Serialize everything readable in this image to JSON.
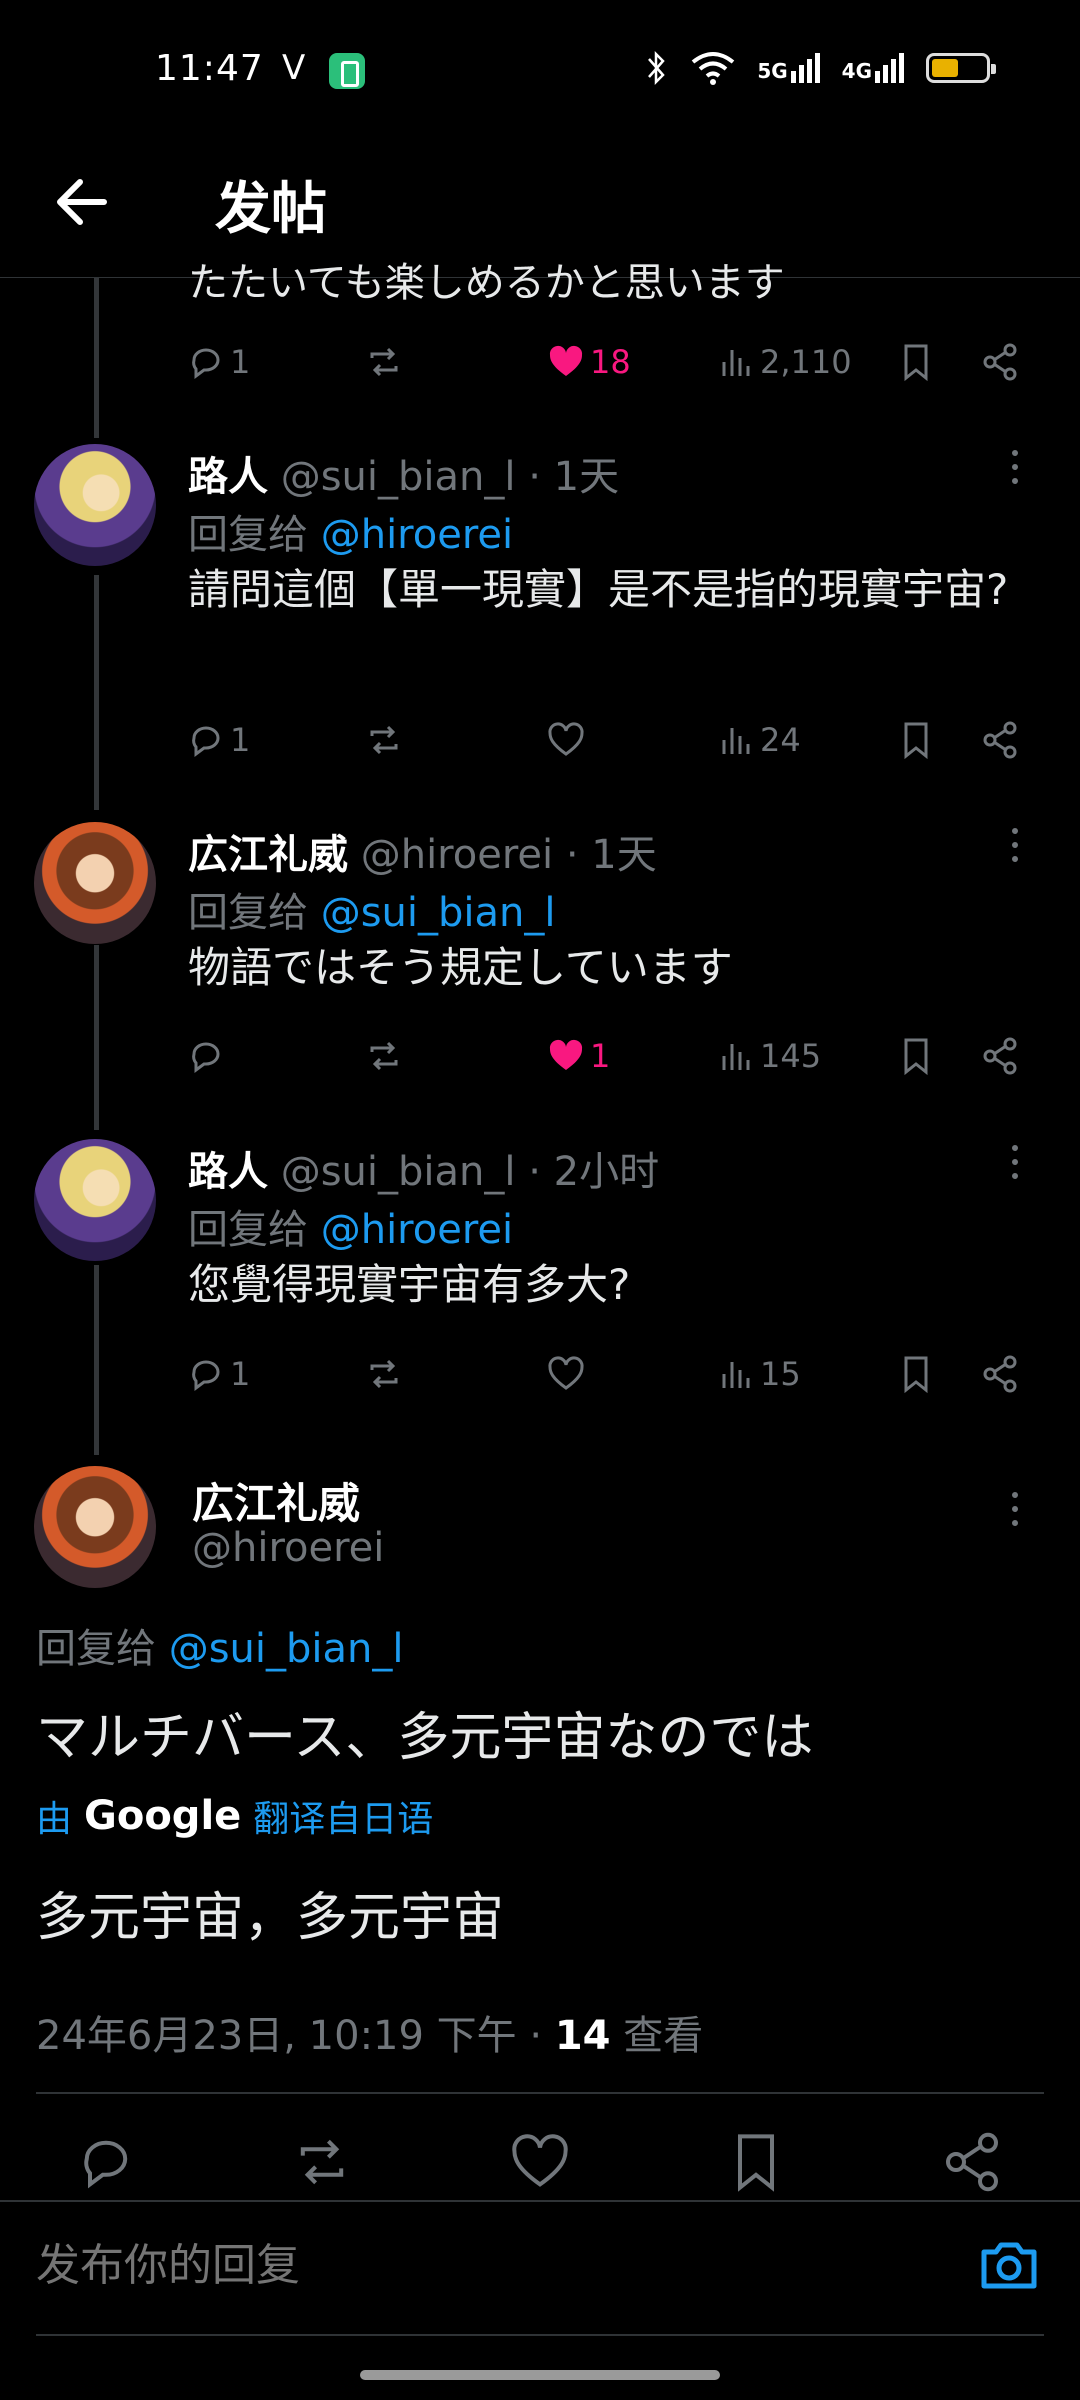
{
  "status_bar": {
    "time": "11:47",
    "carrier_glyph": "V",
    "net1": "5G",
    "net2": "4G"
  },
  "header": {
    "title": "发帖"
  },
  "thread": {
    "cut_text": "たたいても楽しめるかと思います",
    "first_actions": {
      "replies": "1",
      "likes": "18",
      "views": "2,110"
    },
    "replies": [
      {
        "name": "路人",
        "handle": "@sui_bian_l",
        "time": "· 1天",
        "reply_label": "回复给",
        "reply_to": "@hiroerei",
        "text": "請問這個【單一現實】是不是指的現實宇宙?",
        "replies": "1",
        "likes": "",
        "views": "24"
      },
      {
        "name": "広江礼威",
        "handle": "@hiroerei",
        "time": "· 1天",
        "reply_label": "回复给",
        "reply_to": "@sui_bian_l",
        "text": "物語ではそう規定しています",
        "replies": "",
        "likes": "1",
        "views": "145"
      },
      {
        "name": "路人",
        "handle": "@sui_bian_l",
        "time": "· 2小时",
        "reply_label": "回复给",
        "reply_to": "@hiroerei",
        "text": "您覺得現實宇宙有多大?",
        "replies": "1",
        "likes": "",
        "views": "15"
      }
    ]
  },
  "main_post": {
    "name": "広江礼威",
    "handle": "@hiroerei",
    "reply_label": "回复给",
    "reply_to": "@sui_bian_l",
    "text": "マルチバース、多元宇宙なのでは",
    "translate_prefix": "由",
    "translate_brand": "Google",
    "translate_suffix": "翻译自日语",
    "translated_text": "多元宇宙，多元宇宙",
    "timestamp": "24年6月23日, 10:19 下午 · ",
    "views_count": "14",
    "views_label": " 查看"
  },
  "reply_bar": {
    "placeholder": "发布你的回复"
  },
  "colors": {
    "like": "#f91880",
    "link": "#1d9bf0",
    "muted": "#71767b"
  }
}
